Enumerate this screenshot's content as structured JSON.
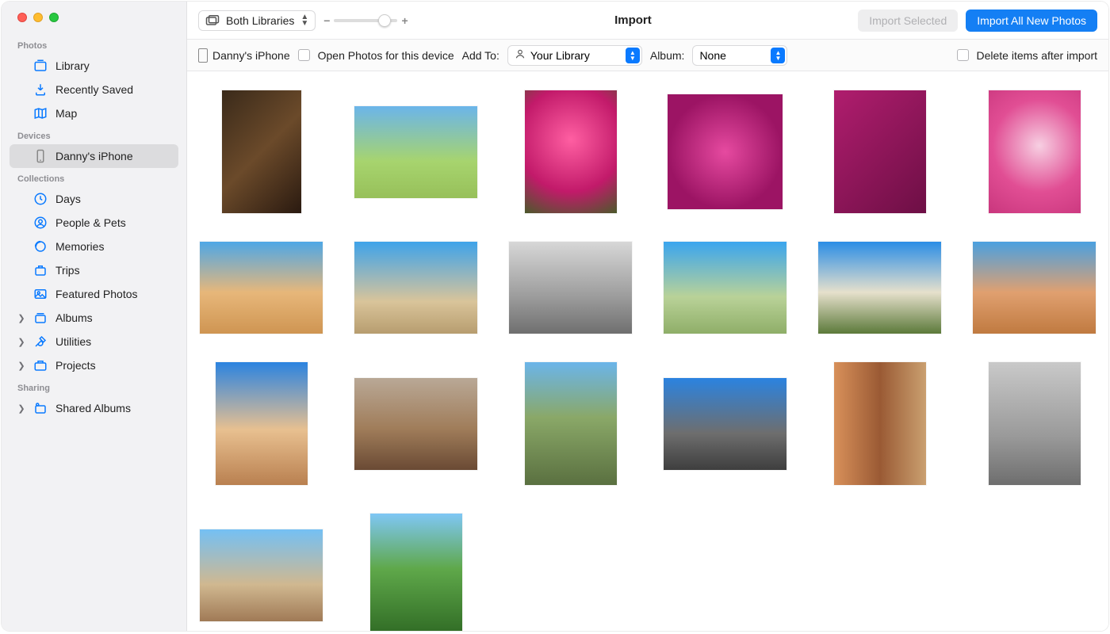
{
  "toolbar": {
    "library_selector_label": "Both Libraries",
    "window_title": "Import",
    "import_selected_label": "Import Selected",
    "import_all_label": "Import All New Photos"
  },
  "subbar": {
    "device_name": "Danny's iPhone",
    "open_photos_label": "Open Photos for this device",
    "add_to_label": "Add To:",
    "add_to_value": "Your Library",
    "album_label": "Album:",
    "album_value": "None",
    "delete_after_label": "Delete items after import"
  },
  "sidebar": {
    "sections": {
      "photos_title": "Photos",
      "devices_title": "Devices",
      "collections_title": "Collections",
      "sharing_title": "Sharing"
    },
    "photos": [
      {
        "label": "Library"
      },
      {
        "label": "Recently Saved"
      },
      {
        "label": "Map"
      }
    ],
    "devices": [
      {
        "label": "Danny's iPhone"
      }
    ],
    "collections": [
      {
        "label": "Days"
      },
      {
        "label": "People & Pets"
      },
      {
        "label": "Memories"
      },
      {
        "label": "Trips"
      },
      {
        "label": "Featured Photos"
      },
      {
        "label": "Albums"
      },
      {
        "label": "Utilities"
      },
      {
        "label": "Projects"
      }
    ],
    "sharing": [
      {
        "label": "Shared Albums"
      }
    ]
  },
  "thumbs": [
    {
      "shape": "tall",
      "g": "linear-gradient(135deg,#3a2a1a,#6b4a2a,#2a1a10)"
    },
    {
      "shape": "landscape",
      "g": "linear-gradient(180deg,#6bb5ea 0%,#a7d46e 60%,#97c05a 100%)"
    },
    {
      "shape": "portrait",
      "g": "radial-gradient(circle at 50% 40%,#ff5fa2,#c21a6a 60%,#4a5a2a)"
    },
    {
      "shape": "square",
      "g": "radial-gradient(circle at 50% 50%,#e64aa0,#9c1464 70%)"
    },
    {
      "shape": "portrait",
      "g": "linear-gradient(135deg,#b01d6e,#6d0f45)"
    },
    {
      "shape": "portrait",
      "g": "radial-gradient(circle at 55% 45%,#f7cfe2,#e14e94 55%,#c9367d)"
    },
    {
      "shape": "landscape",
      "g": "linear-gradient(180deg,#4ea7e6 0%,#e7b77a 55%,#cf9552 100%)"
    },
    {
      "shape": "landscape",
      "g": "linear-gradient(180deg,#3ea3ea 0%,#d9c49a 65%,#b79d6f 100%)"
    },
    {
      "shape": "landscape",
      "g": "linear-gradient(180deg,#d7d7d7 0%,#9c9c9c 60%,#6f6f6f 100%)"
    },
    {
      "shape": "landscape",
      "g": "linear-gradient(180deg,#3aa5ef 0%,#b9d298 60%,#8fae68 100%)"
    },
    {
      "shape": "landscape",
      "g": "linear-gradient(180deg,#2a8de6 0%,#e6e0cc 55%,#5c7a3a 100%)"
    },
    {
      "shape": "landscape",
      "g": "linear-gradient(180deg,#4aa0e0 0%,#e0a070 55%,#c07a40 100%)"
    },
    {
      "shape": "portrait",
      "g": "linear-gradient(180deg,#2b83e0 0%,#e8c090 55%,#b98050 100%)"
    },
    {
      "shape": "landscape",
      "g": "linear-gradient(180deg,#b9a896 0%,#a07d5a 55%,#6a4a34 100%)"
    },
    {
      "shape": "portrait",
      "g": "linear-gradient(180deg,#6bb5ea 0%,#8aa868 45%,#5a7040 100%)"
    },
    {
      "shape": "landscape",
      "g": "linear-gradient(180deg,#2b83e0 0%,#6e6e6e 60%,#3e3e3e 100%)"
    },
    {
      "shape": "portrait",
      "g": "linear-gradient(90deg,#d8905a 0%,#9a5a34 50%,#caa070 100%)"
    },
    {
      "shape": "portrait",
      "g": "linear-gradient(180deg,#c9c9c9 0%,#9a9a9a 60%,#6e6e6e 100%)"
    },
    {
      "shape": "landscape",
      "g": "linear-gradient(180deg,#74c0f4 0%,#d0b890 60%,#a07a56 100%)"
    },
    {
      "shape": "portrait",
      "g": "linear-gradient(180deg,#7fc7f5 0%,#5fa84a 45%,#2f6a24 100%)"
    }
  ]
}
